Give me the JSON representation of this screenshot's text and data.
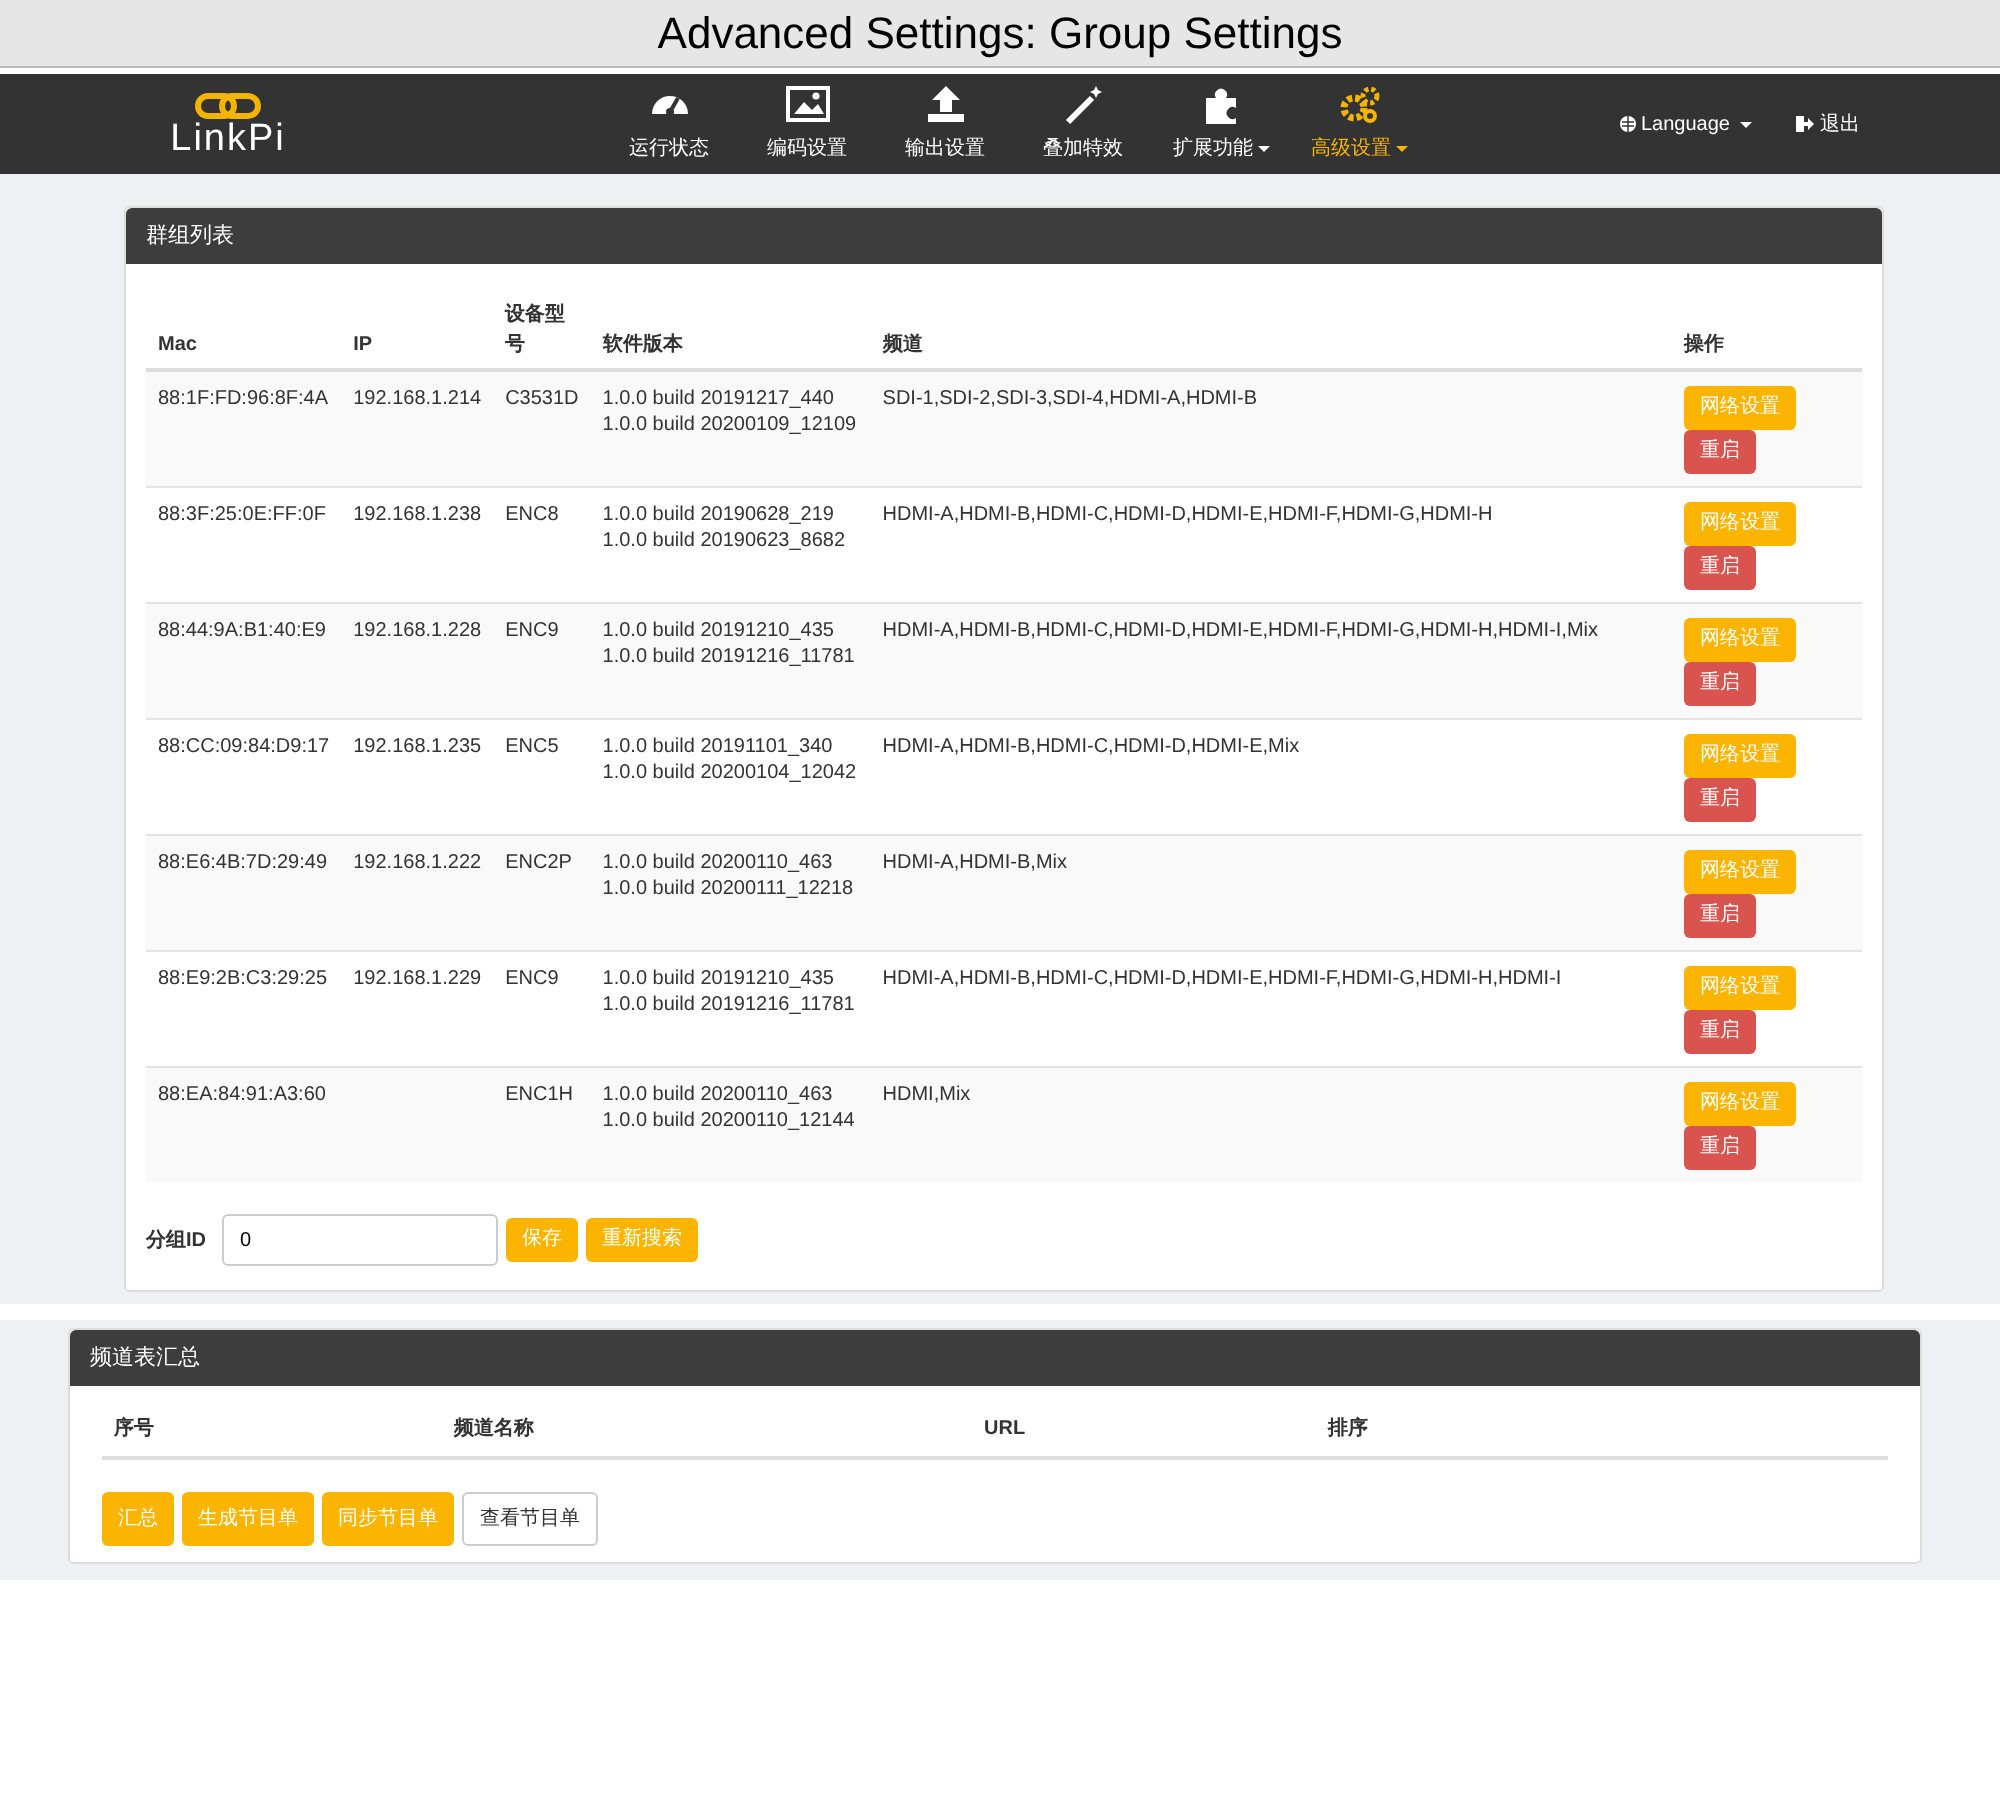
{
  "caption": "Advanced Settings: Group Settings",
  "navbar": {
    "brand": "LinkPi",
    "items": [
      {
        "label": "运行状态",
        "dropdown": false,
        "selected": false
      },
      {
        "label": "编码设置",
        "dropdown": false,
        "selected": false
      },
      {
        "label": "输出设置",
        "dropdown": false,
        "selected": false
      },
      {
        "label": "叠加特效",
        "dropdown": false,
        "selected": false
      },
      {
        "label": "扩展功能",
        "dropdown": true,
        "selected": false
      },
      {
        "label": "高级设置",
        "dropdown": true,
        "selected": true
      }
    ],
    "language": "Language",
    "logout": "退出"
  },
  "group_panel": {
    "title": "群组列表",
    "columns": [
      "Mac",
      "IP",
      "设备型号",
      "软件版本",
      "频道",
      "操作"
    ],
    "rows": [
      {
        "mac": "88:1F:FD:96:8F:4A",
        "ip": "192.168.1.214",
        "model": "C3531D",
        "versions": [
          "1.0.0 build 20191217_440",
          "1.0.0 build 20200109_12109"
        ],
        "channels": "SDI-1,SDI-2,SDI-3,SDI-4,HDMI-A,HDMI-B",
        "actions": [
          "网络设置",
          "重启"
        ]
      },
      {
        "mac": "88:3F:25:0E:FF:0F",
        "ip": "192.168.1.238",
        "model": "ENC8",
        "versions": [
          "1.0.0 build 20190628_219",
          "1.0.0 build 20190623_8682"
        ],
        "channels": "HDMI-A,HDMI-B,HDMI-C,HDMI-D,HDMI-E,HDMI-F,HDMI-G,HDMI-H",
        "actions": [
          "网络设置",
          "重启"
        ]
      },
      {
        "mac": "88:44:9A:B1:40:E9",
        "ip": "192.168.1.228",
        "model": "ENC9",
        "versions": [
          "1.0.0 build 20191210_435",
          "1.0.0 build 20191216_11781"
        ],
        "channels": "HDMI-A,HDMI-B,HDMI-C,HDMI-D,HDMI-E,HDMI-F,HDMI-G,HDMI-H,HDMI-I,Mix",
        "actions": [
          "网络设置",
          "重启"
        ]
      },
      {
        "mac": "88:CC:09:84:D9:17",
        "ip": "192.168.1.235",
        "model": "ENC5",
        "versions": [
          "1.0.0 build 20191101_340",
          "1.0.0 build 20200104_12042"
        ],
        "channels": "HDMI-A,HDMI-B,HDMI-C,HDMI-D,HDMI-E,Mix",
        "actions": [
          "网络设置",
          "重启"
        ]
      },
      {
        "mac": "88:E6:4B:7D:29:49",
        "ip": "192.168.1.222",
        "model": "ENC2P",
        "versions": [
          "1.0.0 build 20200110_463",
          "1.0.0 build 20200111_12218"
        ],
        "channels": "HDMI-A,HDMI-B,Mix",
        "actions": [
          "网络设置",
          "重启"
        ]
      },
      {
        "mac": "88:E9:2B:C3:29:25",
        "ip": "192.168.1.229",
        "model": "ENC9",
        "versions": [
          "1.0.0 build 20191210_435",
          "1.0.0 build 20191216_11781"
        ],
        "channels": "HDMI-A,HDMI-B,HDMI-C,HDMI-D,HDMI-E,HDMI-F,HDMI-G,HDMI-H,HDMI-I",
        "actions": [
          "网络设置",
          "重启"
        ]
      },
      {
        "mac": "88:EA:84:91:A3:60",
        "model": "ENC1H",
        "versions": [
          "1.0.0 build 20200110_463",
          "1.0.0 build 20200110_12144"
        ],
        "channels": "HDMI,Mix",
        "actions": [
          "网络设置",
          "重启"
        ]
      }
    ],
    "group_id": {
      "label": "分组ID",
      "value": "0"
    },
    "buttons": [
      "保存",
      "重新搜索"
    ]
  },
  "channel_panel": {
    "title": "频道表汇总",
    "columns": [
      "序号",
      "频道名称",
      "URL",
      "排序"
    ],
    "buttons": [
      {
        "label": "汇总",
        "kind": "primary"
      },
      {
        "label": "生成节目单",
        "kind": "primary"
      },
      {
        "label": "同步节目单",
        "kind": "primary"
      },
      {
        "label": "查看节目单",
        "kind": "outline"
      }
    ]
  }
}
